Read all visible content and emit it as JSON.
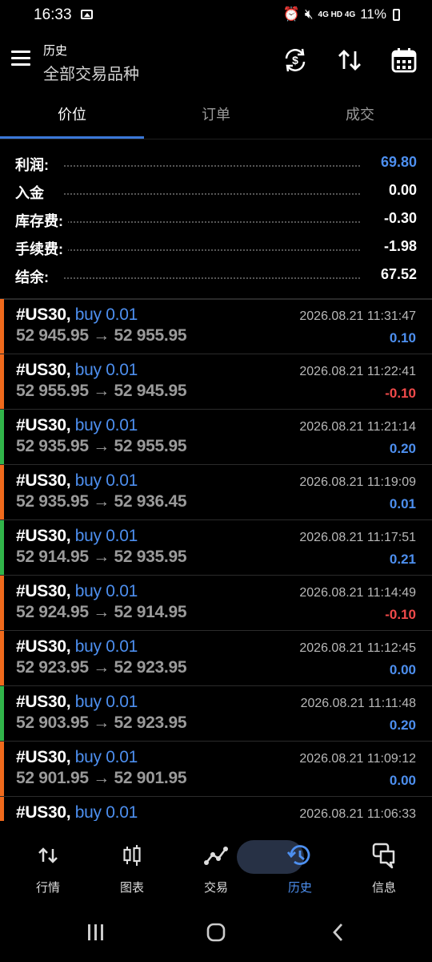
{
  "status_bar": {
    "time": "16:33",
    "indicators": "4G HD 4G",
    "battery": "11%"
  },
  "app_bar": {
    "title": "历史",
    "subtitle": "全部交易品种"
  },
  "tabs": [
    {
      "label": "价位",
      "active": true
    },
    {
      "label": "订单",
      "active": false
    },
    {
      "label": "成交",
      "active": false
    }
  ],
  "summary": [
    {
      "label": "利润:",
      "value": "69.80",
      "highlight": true
    },
    {
      "label": "入金",
      "value": "0.00",
      "highlight": false
    },
    {
      "label": "库存费:",
      "value": "-0.30",
      "highlight": false
    },
    {
      "label": "手续费:",
      "value": "-1.98",
      "highlight": false
    },
    {
      "label": "结余:",
      "value": "67.52",
      "highlight": false
    }
  ],
  "deals": [
    {
      "symbol": "#US30,",
      "type": "buy 0.01",
      "prices": "52 945.95 → 52 955.95",
      "time": "2026.08.21 11:31:47",
      "profit": "0.10",
      "bar_color": "#f06a1c",
      "profit_color": "#4d8fef"
    },
    {
      "symbol": "#US30,",
      "type": "buy 0.01",
      "prices": "52 955.95 → 52 945.95",
      "time": "2026.08.21 11:22:41",
      "profit": "-0.10",
      "bar_color": "#f06a1c",
      "profit_color": "#f04a4a"
    },
    {
      "symbol": "#US30,",
      "type": "buy 0.01",
      "prices": "52 935.95 → 52 955.95",
      "time": "2026.08.21 11:21:14",
      "profit": "0.20",
      "bar_color": "#31b44a",
      "profit_color": "#4d8fef"
    },
    {
      "symbol": "#US30,",
      "type": "buy 0.01",
      "prices": "52 935.95 → 52 936.45",
      "time": "2026.08.21 11:19:09",
      "profit": "0.01",
      "bar_color": "#f06a1c",
      "profit_color": "#4d8fef"
    },
    {
      "symbol": "#US30,",
      "type": "buy 0.01",
      "prices": "52 914.95 → 52 935.95",
      "time": "2026.08.21 11:17:51",
      "profit": "0.21",
      "bar_color": "#31b44a",
      "profit_color": "#4d8fef"
    },
    {
      "symbol": "#US30,",
      "type": "buy 0.01",
      "prices": "52 924.95 → 52 914.95",
      "time": "2026.08.21 11:14:49",
      "profit": "-0.10",
      "bar_color": "#f06a1c",
      "profit_color": "#f04a4a"
    },
    {
      "symbol": "#US30,",
      "type": "buy 0.01",
      "prices": "52 923.95 → 52 923.95",
      "time": "2026.08.21 11:12:45",
      "profit": "0.00",
      "bar_color": "#f06a1c",
      "profit_color": "#4d8fef"
    },
    {
      "symbol": "#US30,",
      "type": "buy 0.01",
      "prices": "52 903.95 → 52 923.95",
      "time": "2026.08.21 11:11:48",
      "profit": "0.20",
      "bar_color": "#31b44a",
      "profit_color": "#4d8fef"
    },
    {
      "symbol": "#US30,",
      "type": "buy 0.01",
      "prices": "52 901.95 → 52 901.95",
      "time": "2026.08.21 11:09:12",
      "profit": "0.00",
      "bar_color": "#f06a1c",
      "profit_color": "#4d8fef"
    },
    {
      "symbol": "#US30,",
      "type": "buy 0.01",
      "prices": "",
      "time": "2026.08.21 11:06:33",
      "profit": "",
      "bar_color": "#f06a1c",
      "profit_color": "#4d8fef"
    }
  ],
  "bottom_nav": [
    {
      "label": "行情",
      "icon": "quotes-arrows-icon",
      "active": false
    },
    {
      "label": "图表",
      "icon": "candlestick-chart-icon",
      "active": false
    },
    {
      "label": "交易",
      "icon": "trade-line-icon",
      "active": false
    },
    {
      "label": "历史",
      "icon": "history-clock-icon",
      "active": true
    },
    {
      "label": "信息",
      "icon": "messages-icon",
      "active": false
    }
  ],
  "colors": {
    "accent": "#4d8fef",
    "loss": "#f04a4a",
    "buy_bar": "#31b44a",
    "sell_bar": "#f06a1c",
    "nav_active_bg": "#273145"
  }
}
